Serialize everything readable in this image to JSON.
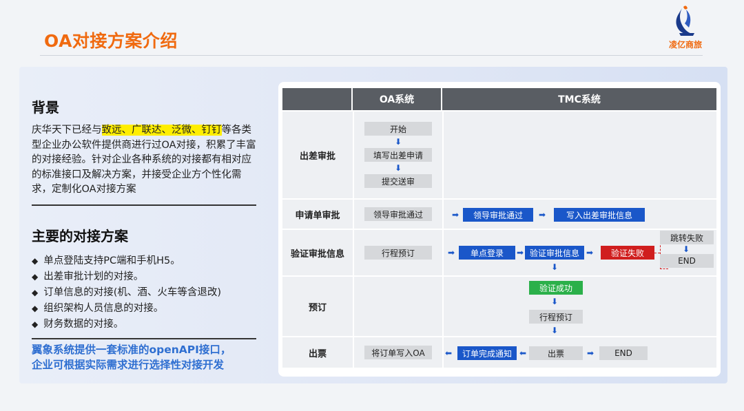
{
  "title": "OA对接方案介绍",
  "logo": {
    "text": "凌亿商旅"
  },
  "left": {
    "bg_heading": "背景",
    "bg_text_pre": "庆华天下已经与",
    "bg_text_highlight": "致远、广联达、泛微、钉钉",
    "bg_text_post": "等各类型企业办公软件提供商进行过OA对接，积累了丰富的对接经验。针对企业各种系统的对接都有相对应的标准接口及解决方案，并接受企业方个性化需求，定制化OA对接方案",
    "plan_heading": "主要的对接方案",
    "bullets": [
      "单点登陆支持PC端和手机H5。",
      "出差审批计划的对接。",
      "订单信息的对接(机、酒、火车等含退改)",
      "组织架构人员信息的对接。",
      "财务数据的对接。"
    ],
    "footer_line1": "翼象系统提供一套标准的openAPI接口，",
    "footer_line2": "企业可根据实际需求进行选择性对接开发"
  },
  "table": {
    "headers": [
      "",
      "OA系统",
      "TMC系统"
    ],
    "rows": [
      {
        "label": "出差审批",
        "oa": [
          "开始",
          "填写出差申请",
          "提交送审"
        ]
      },
      {
        "label": "申请单审批",
        "oa": [
          "领导审批通过"
        ],
        "tmc": [
          "领导审批通过",
          "写入出差审批信息"
        ]
      },
      {
        "label": "验证审批信息",
        "oa": [
          "行程预订"
        ],
        "tmc": [
          "单点登录",
          "验证审批信息",
          "验证失败",
          "跳转失败",
          "END"
        ]
      },
      {
        "label": "预订",
        "tmc": [
          "验证成功",
          "行程预订"
        ]
      },
      {
        "label": "出票",
        "oa": [
          "将订单写入OA"
        ],
        "tmc": [
          "订单完成通知",
          "出票",
          "END"
        ]
      }
    ]
  },
  "colors": {
    "accent": "#f06a10",
    "blue": "#1a57c9",
    "red": "#d01e1e",
    "green": "#2bb04a",
    "footer": "#2f6fd1"
  },
  "icons": {
    "arrow": "arrow-icon",
    "bullet": "diamond-icon"
  }
}
